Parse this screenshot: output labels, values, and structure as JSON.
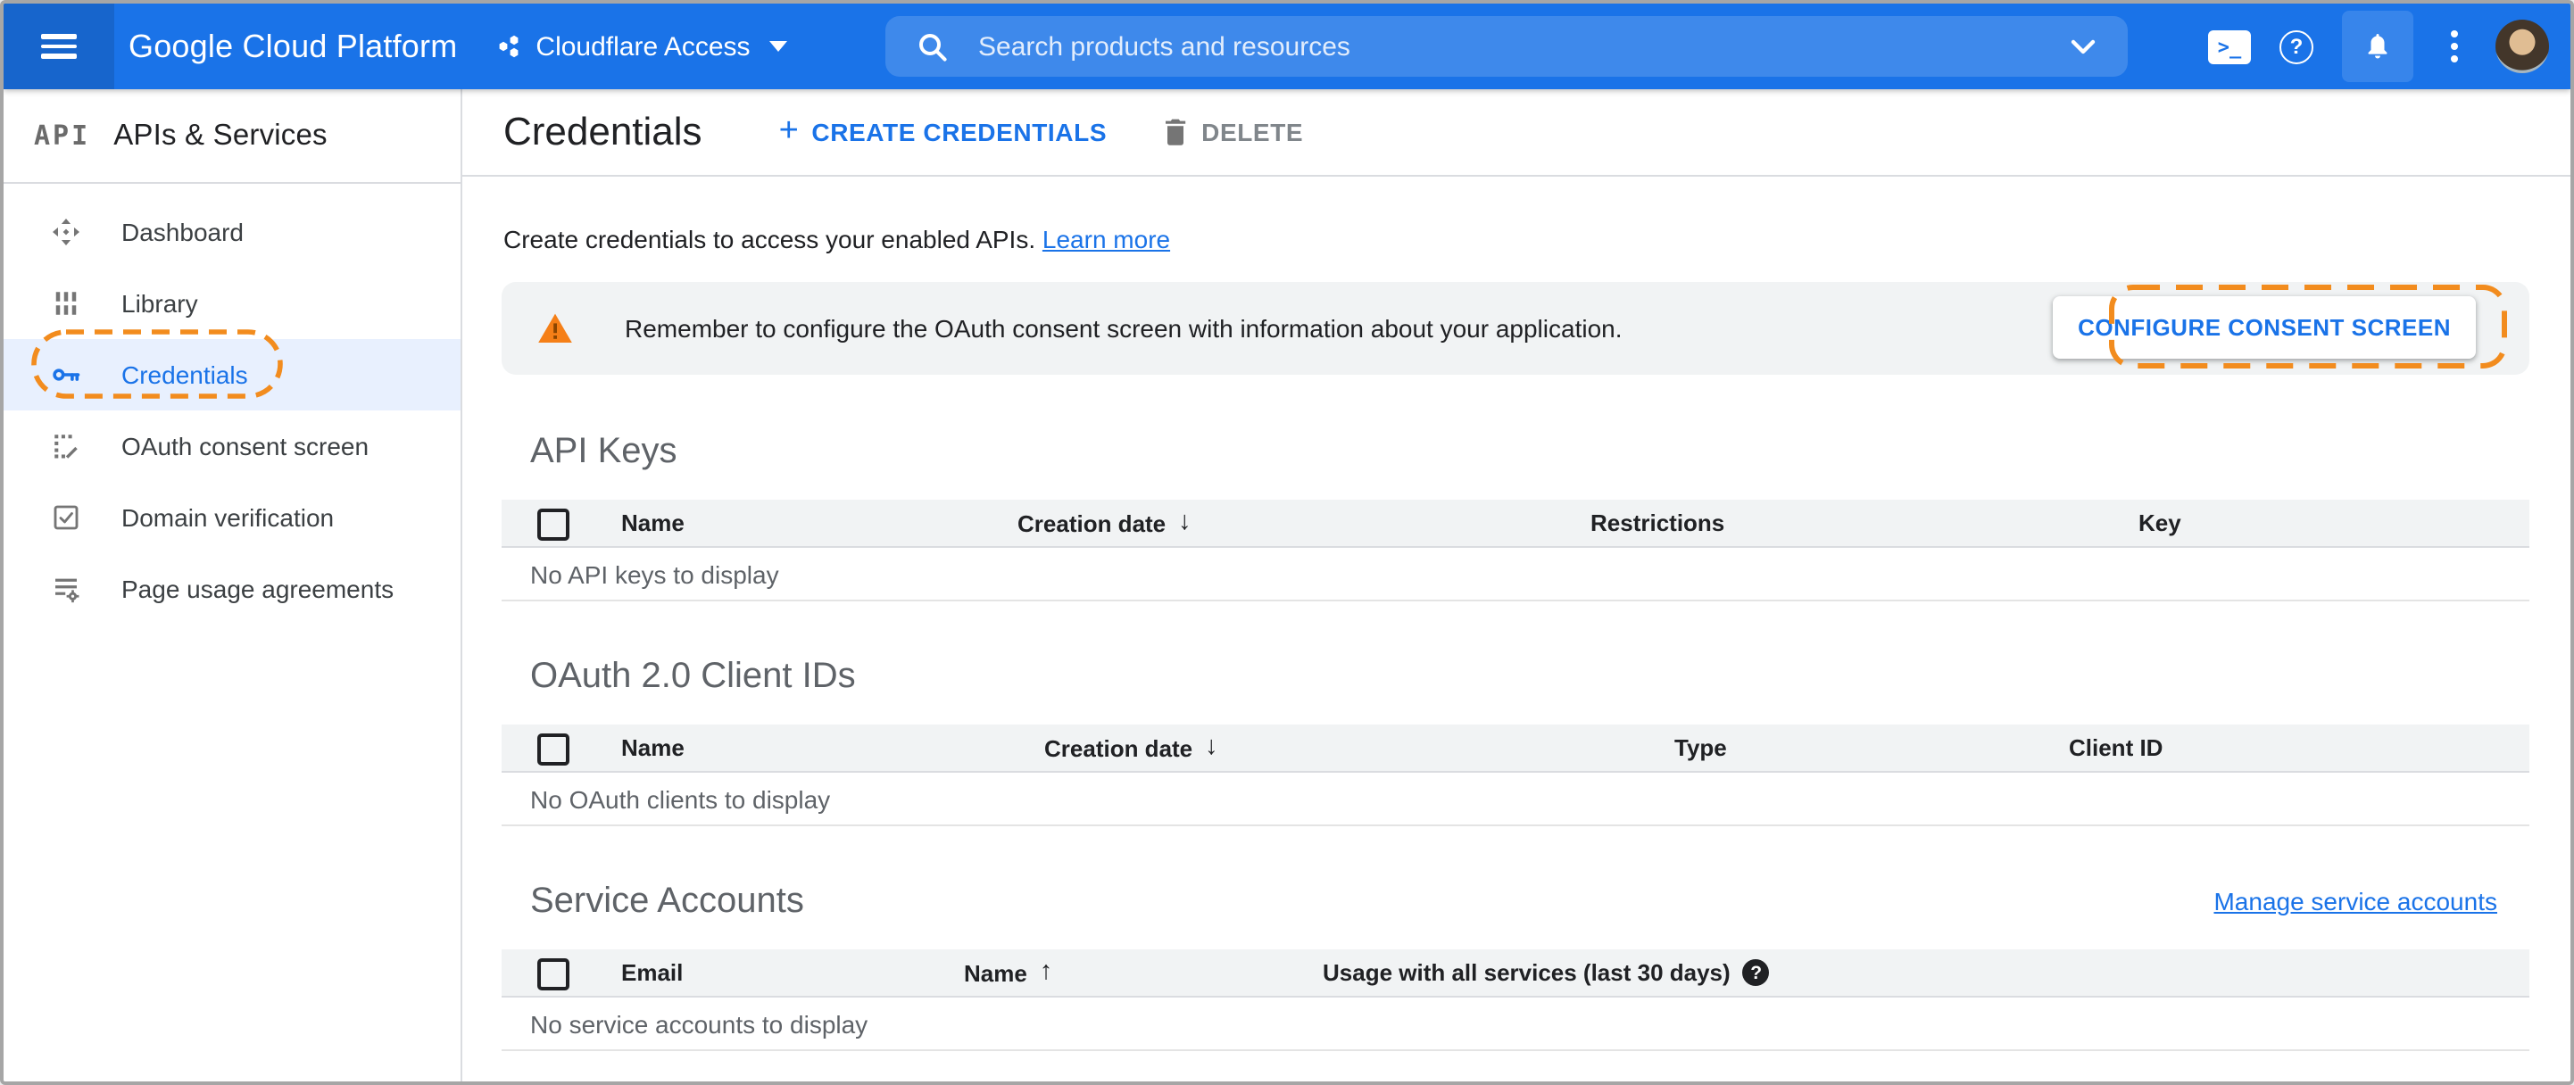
{
  "header": {
    "brand": "Google Cloud Platform",
    "project": "Cloudflare Access",
    "search_placeholder": "Search products and resources",
    "shell_glyph": ">_",
    "help_glyph": "?"
  },
  "sidebar": {
    "logo": "API",
    "title": "APIs & Services",
    "items": [
      {
        "label": "Dashboard"
      },
      {
        "label": "Library"
      },
      {
        "label": "Credentials",
        "selected": true,
        "annotated": true
      },
      {
        "label": "OAuth consent screen"
      },
      {
        "label": "Domain verification"
      },
      {
        "label": "Page usage agreements"
      }
    ]
  },
  "toolbar": {
    "title": "Credentials",
    "create_label": "CREATE CREDENTIALS",
    "create_plus": "+",
    "delete_label": "DELETE"
  },
  "intro": {
    "text": "Create credentials to access your enabled APIs.",
    "link": "Learn more"
  },
  "banner": {
    "message": "Remember to configure the OAuth consent screen with information about your application.",
    "action": "CONFIGURE CONSENT SCREEN"
  },
  "sections": {
    "api_keys": {
      "title": "API Keys",
      "columns": {
        "name": "Name",
        "creation": "Creation date",
        "restrictions": "Restrictions",
        "key": "Key"
      },
      "sort_arrow": "↓",
      "empty": "No API keys to display"
    },
    "oauth": {
      "title": "OAuth 2.0 Client IDs",
      "columns": {
        "name": "Name",
        "creation": "Creation date",
        "type": "Type",
        "client_id": "Client ID"
      },
      "sort_arrow": "↓",
      "empty": "No OAuth clients to display"
    },
    "service_accounts": {
      "title": "Service Accounts",
      "link": "Manage service accounts",
      "columns": {
        "email": "Email",
        "name": "Name",
        "usage": "Usage with all services (last 30 days)"
      },
      "sort_arrow": "↑",
      "help_glyph": "?",
      "empty": "No service accounts to display"
    }
  },
  "colors": {
    "header_blue": "#1a73e8",
    "header_dark_blue": "#1765cc",
    "selected_item_bg": "#e8f0fe",
    "link_blue": "#1a73e8",
    "annotation_orange": "#F28C1E",
    "warning_orange": "#F57F17",
    "banner_bg": "#f1f3f4"
  }
}
